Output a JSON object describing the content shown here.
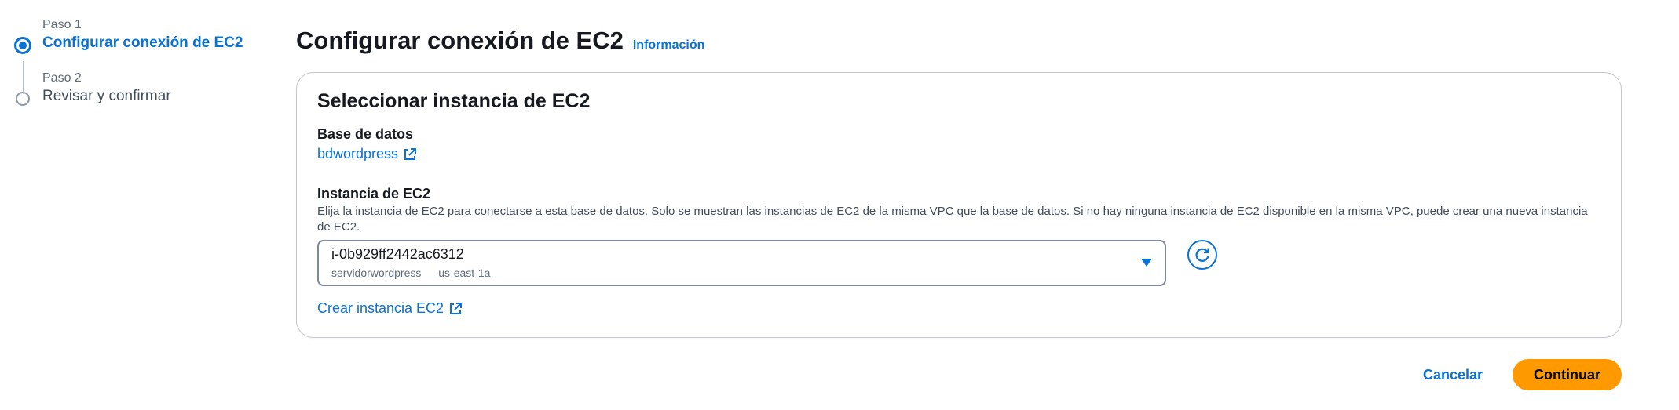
{
  "wizard": {
    "steps": [
      {
        "label": "Paso 1",
        "title": "Configurar conexión de EC2",
        "state": "active"
      },
      {
        "label": "Paso 2",
        "title": "Revisar y confirmar",
        "state": "inactive"
      }
    ]
  },
  "header": {
    "title": "Configurar conexión de EC2",
    "info_link": "Información"
  },
  "panel": {
    "title": "Seleccionar instancia de EC2",
    "database": {
      "label": "Base de datos",
      "value": "bdwordpress",
      "icon": "external-link-icon"
    },
    "ec2_instance": {
      "label": "Instancia de EC2",
      "description": "Elija la instancia de EC2 para conectarse a esta base de datos. Solo se muestran las instancias de EC2 de la misma VPC que la base de datos. Si no hay ninguna instancia de EC2 disponible en la misma VPC, puede crear una nueva instancia de EC2.",
      "selected": "i-0b929ff2442ac6312",
      "tags": [
        "servidorwordpress",
        "us-east-1a"
      ],
      "refresh_icon": "refresh-icon"
    },
    "create_link": "Crear instancia EC2"
  },
  "actions": {
    "cancel": "Cancelar",
    "continue": "Continuar"
  },
  "colors": {
    "link": "#0972d3",
    "primary_button": "#ff9900",
    "text": "#16191f"
  }
}
